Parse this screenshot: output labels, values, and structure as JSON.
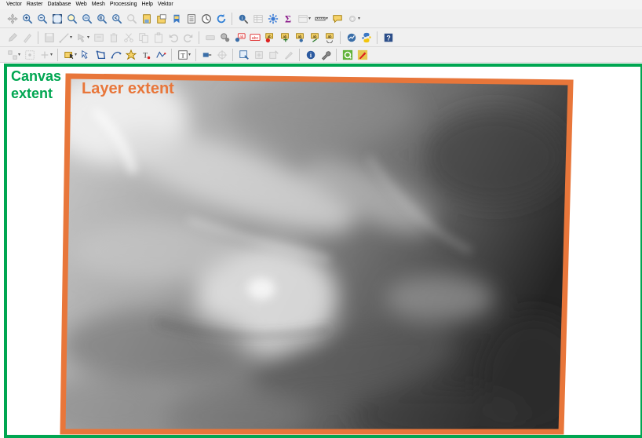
{
  "menu": {
    "items": [
      "Vector",
      "Raster",
      "Database",
      "Web",
      "Mesh",
      "Processing",
      "Help",
      "Vektor"
    ]
  },
  "toolbars": {
    "navigation": [
      "pan-icon",
      "zoom-in-icon",
      "zoom-out-icon",
      "zoom-full-icon",
      "zoom-selection-icon",
      "zoom-layer-icon",
      "zoom-native-icon",
      "zoom-last-icon",
      "zoom-next-icon",
      "new-bookmark-icon",
      "show-bookmarks-icon",
      "temporal-controller-icon",
      "refresh-icon",
      "identify-icon",
      "attribute-table-icon",
      "settings-icon",
      "statistics-icon",
      "measure-icon",
      "annotation-icon",
      "map-tips-icon"
    ],
    "digitizing": [
      "edit-pencil-icon",
      "toggle-editing-icon",
      "save-edits-icon",
      "digitize-line-icon",
      "vertex-tool-icon",
      "modify-attributes-icon",
      "delete-selected-icon",
      "cut-features-icon",
      "copy-features-icon",
      "paste-features-icon",
      "undo-icon",
      "redo-icon",
      "label-toolbar-icon",
      "pin-labels-icon",
      "show-hide-labels-icon",
      "move-label-icon",
      "rotate-label-icon",
      "change-label-icon",
      "layer-diagram-icon",
      "python-icon",
      "help-icon"
    ],
    "advanced": [
      "snapping-icon",
      "advanced-digitize-icon",
      "select-features-icon",
      "select-polygon-icon",
      "select-freehand-icon",
      "select-radius-icon",
      "deselect-icon",
      "text-annotation-icon",
      "tracing-icon",
      "measure-line-icon",
      "identify-results-icon",
      "wrench-icon",
      "qgis-plugin-icon",
      "edit-style-icon"
    ]
  },
  "canvas": {
    "label_line1": "Canvas",
    "label_line2": "extent",
    "frame_color": "#00a651"
  },
  "layer": {
    "label": "Layer extent",
    "frame_color": "#e8763a",
    "type": "grayscale-dem-raster"
  }
}
